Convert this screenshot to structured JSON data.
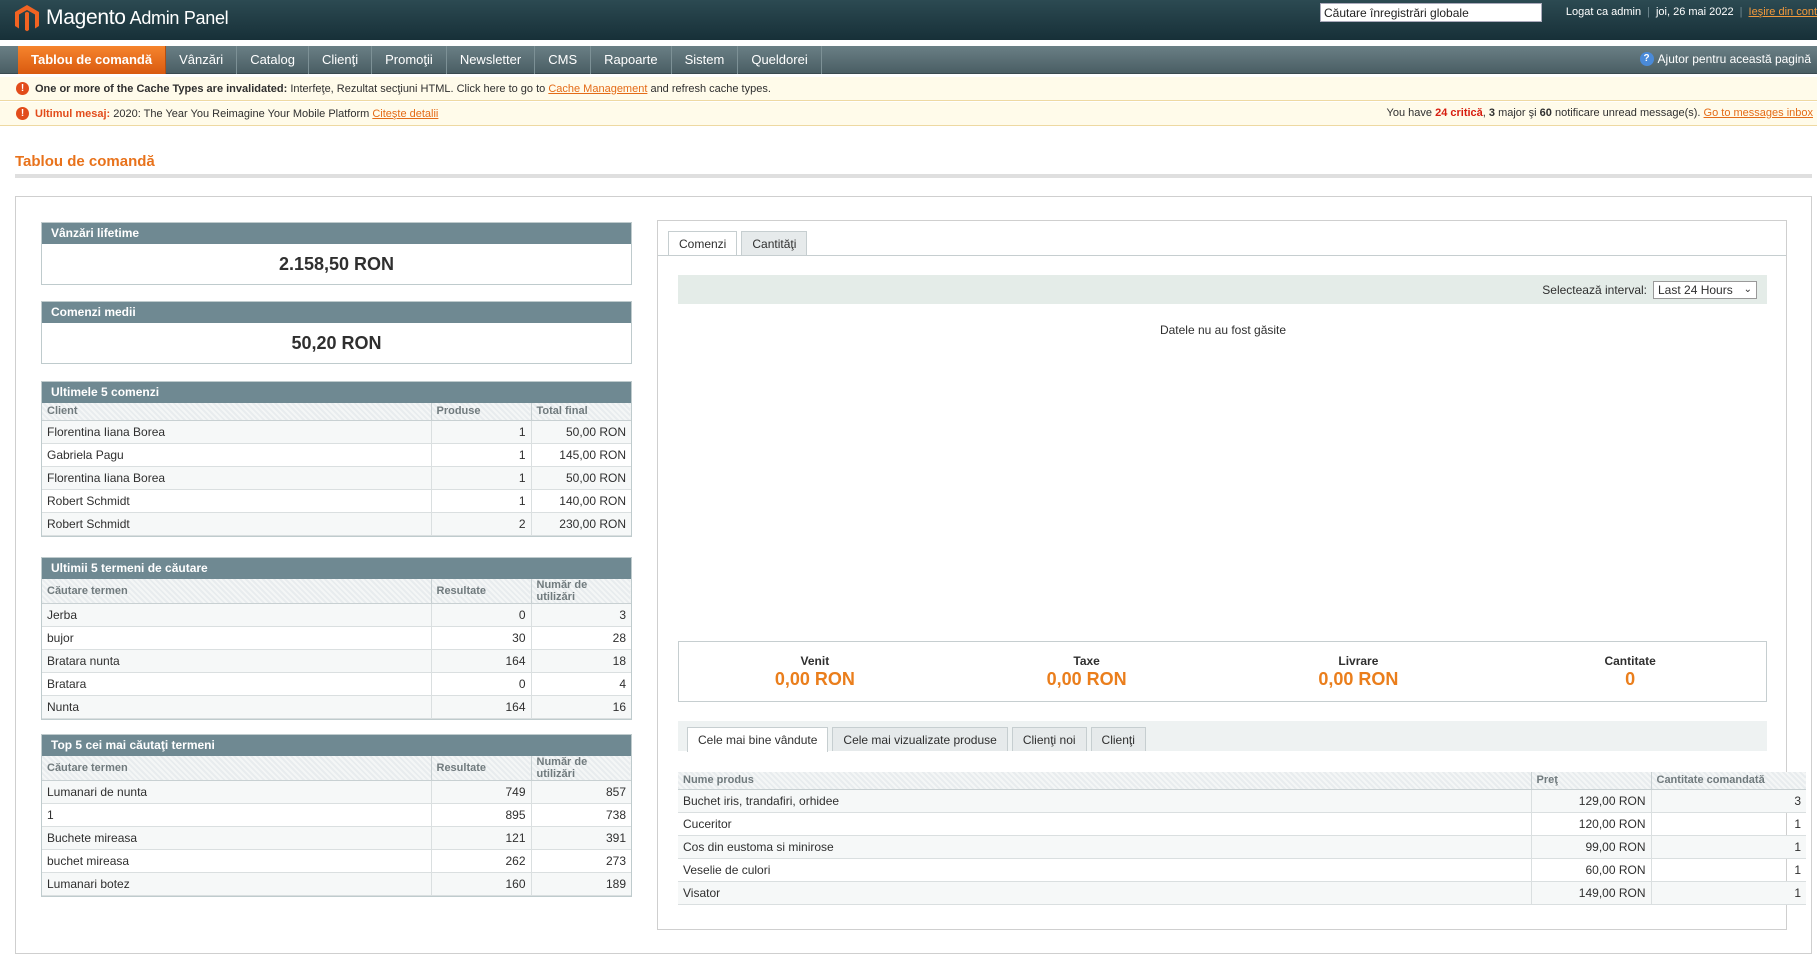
{
  "header": {
    "logo_main": "Magento",
    "logo_sub": "Admin Panel",
    "search_value": "Căutare înregistrări globale",
    "logged_in": "Logat ca admin",
    "date": "joi, 26 mai 2022",
    "logout": "Ieşire din cont"
  },
  "nav": {
    "items": [
      "Tablou de comandă",
      "Vânzări",
      "Catalog",
      "Clienţi",
      "Promoţii",
      "Newsletter",
      "CMS",
      "Rapoarte",
      "Sistem",
      "Queldorei"
    ],
    "active": "Tablou de comandă",
    "help": "Ajutor pentru această pagină"
  },
  "notices": {
    "cache_bold": "One or more of the Cache Types are invalidated:",
    "cache_text": " Interfeţe, Rezultat secţiuni HTML. Click here to go to ",
    "cache_link": "Cache Management",
    "cache_tail": " and refresh cache types.",
    "msg_bold": "Ultimul mesaj:",
    "msg_text": " 2020: The Year You Reimagine Your Mobile Platform ",
    "msg_link": "Citeşte detalii",
    "inbox_pre": "You have ",
    "inbox_critical": "24 critică",
    "inbox_mid1": ", ",
    "inbox_major": "3",
    "inbox_mid2": " major şi ",
    "inbox_notice": "60",
    "inbox_post": " notificare unread message(s). ",
    "inbox_link": "Go to messages inbox"
  },
  "page": {
    "title": "Tablou de comandă"
  },
  "lifetime": {
    "title": "Vânzări lifetime",
    "value": "2.158,50 RON"
  },
  "average": {
    "title": "Comenzi medii",
    "value": "50,20 RON"
  },
  "last_orders": {
    "title": "Ultimele 5 comenzi",
    "headers": [
      "Client",
      "Produse",
      "Total final"
    ],
    "rows": [
      [
        "Florentina Iiana Borea",
        "1",
        "50,00 RON"
      ],
      [
        "Gabriela Pagu",
        "1",
        "145,00 RON"
      ],
      [
        "Florentina Iiana Borea",
        "1",
        "50,00 RON"
      ],
      [
        "Robert Schmidt",
        "1",
        "140,00 RON"
      ],
      [
        "Robert Schmidt",
        "2",
        "230,00 RON"
      ]
    ]
  },
  "last_search": {
    "title": "Ultimii 5 termeni de căutare",
    "headers": [
      "Căutare termen",
      "Resultate",
      "Număr de utilizări"
    ],
    "rows": [
      [
        "Jerba",
        "0",
        "3"
      ],
      [
        "bujor",
        "30",
        "28"
      ],
      [
        "Bratara nunta",
        "164",
        "18"
      ],
      [
        "Bratara",
        "0",
        "4"
      ],
      [
        "Nunta",
        "164",
        "16"
      ]
    ]
  },
  "top_search": {
    "title": "Top 5 cei mai căutaţi termeni",
    "headers": [
      "Căutare termen",
      "Resultate",
      "Număr de utilizări"
    ],
    "rows": [
      [
        "Lumanari de nunta",
        "749",
        "857"
      ],
      [
        "1",
        "895",
        "738"
      ],
      [
        "Buchete mireasa",
        "121",
        "391"
      ],
      [
        "buchet mireasa",
        "262",
        "273"
      ],
      [
        "Lumanari botez",
        "160",
        "189"
      ]
    ]
  },
  "chart_panel": {
    "tabs": [
      "Comenzi",
      "Cantităţi"
    ],
    "interval_label": "Selectează interval:",
    "interval_value": "Last 24 Hours",
    "no_data": "Datele nu au fost găsite"
  },
  "totals": [
    {
      "label": "Venit",
      "value": "0,00 RON"
    },
    {
      "label": "Taxe",
      "value": "0,00 RON"
    },
    {
      "label": "Livrare",
      "value": "0,00 RON"
    },
    {
      "label": "Cantitate",
      "value": "0"
    }
  ],
  "bottom_tabs": [
    "Cele mai bine vândute",
    "Cele mai vizualizate produse",
    "Clienţi noi",
    "Clienţi"
  ],
  "bestsellers": {
    "headers": [
      "Nume produs",
      "Preţ",
      "Cantitate comandată"
    ],
    "rows": [
      [
        "Buchet iris, trandafiri, orhidee",
        "129,00 RON",
        "3"
      ],
      [
        "Cuceritor",
        "120,00 RON",
        "1"
      ],
      [
        "Cos din eustoma si minirose",
        "99,00 RON",
        "1"
      ],
      [
        "Veselie de culori",
        "60,00 RON",
        "1"
      ],
      [
        "Visator",
        "149,00 RON",
        "1"
      ]
    ]
  },
  "colors": {
    "accent": "#e8721b",
    "header_bg": "#173038",
    "box_head": "#6f8992"
  }
}
